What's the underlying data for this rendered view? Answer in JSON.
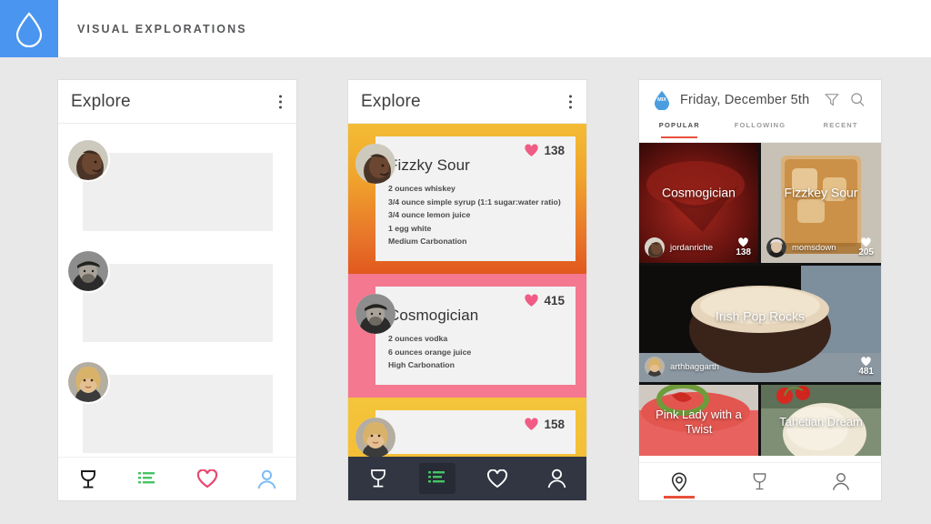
{
  "header": {
    "title": "VISUAL EXPLORATIONS",
    "logo_icon": "water-droplet-icon",
    "logo_bg": "#4a95f0"
  },
  "phone1": {
    "title": "Explore",
    "menu_icon": "kebab-menu-icon",
    "placeholder_rows": [
      {
        "avatar": "avatar-man-smiling"
      },
      {
        "avatar": "avatar-man-cap"
      },
      {
        "avatar": "avatar-woman-blonde"
      }
    ],
    "nav": [
      {
        "icon": "goblet-icon",
        "label": "Drinks",
        "color": "#1a1a1a"
      },
      {
        "icon": "list-icon",
        "label": "Recipes",
        "color": "#45c463"
      },
      {
        "icon": "heart-icon",
        "label": "Favorites",
        "color": "#e8486e"
      },
      {
        "icon": "person-icon",
        "label": "Profile",
        "color": "#7dbcf5"
      }
    ]
  },
  "phone2": {
    "title": "Explore",
    "menu_icon": "kebab-menu-icon",
    "cards": [
      {
        "name": "Fizzky Sour",
        "likes": "138",
        "avatar": "avatar-man-smiling",
        "ingredients": [
          "2 ounces whiskey",
          "3/4 ounce simple syrup (1:1 sugar:water ratio)",
          "3/4 ounce lemon juice",
          "1 egg white",
          "Medium Carbonation"
        ]
      },
      {
        "name": "Cosmogician",
        "likes": "415",
        "avatar": "avatar-man-cap",
        "ingredients": [
          "2 ounces vodka",
          "6 ounces orange juice",
          "High Carbonation"
        ]
      },
      {
        "name": "",
        "likes": "158",
        "avatar": "avatar-woman-blonde",
        "ingredients": []
      }
    ],
    "nav": [
      {
        "icon": "goblet-icon",
        "label": "Drinks",
        "active": false
      },
      {
        "icon": "list-icon",
        "label": "Recipes",
        "active": true
      },
      {
        "icon": "heart-icon",
        "label": "Favorites",
        "active": false
      },
      {
        "icon": "person-icon",
        "label": "Profile",
        "active": false
      }
    ],
    "nav_bg": "#313642",
    "nav_active_color": "#45c463"
  },
  "phone3": {
    "logo_icon": "droplet-mix-logo",
    "logo_text": "MIX",
    "date": "Friday, December 5th",
    "filter_icon": "filter-icon",
    "search_icon": "search-icon",
    "tabs": [
      {
        "label": "POPULAR",
        "active": true
      },
      {
        "label": "FOLLOWING",
        "active": false
      },
      {
        "label": "RECENT",
        "active": false
      }
    ],
    "accent_color": "#e8503a",
    "tiles": [
      {
        "name": "Cosmogician",
        "user": "jordanriche",
        "likes": "138",
        "avatar": "avatar-man-smiling"
      },
      {
        "name": "Fizzkey Sour",
        "user": "momsdown",
        "likes": "205",
        "avatar": "avatar-older-woman"
      },
      {
        "name": "Irish Pop Rocks",
        "user": "arthbaggarth",
        "likes": "481",
        "avatar": "avatar-woman-blonde"
      },
      {
        "name": "Pink Lady with a Twist",
        "user": "",
        "likes": "",
        "avatar": ""
      },
      {
        "name": "Tahetian Dream",
        "user": "",
        "likes": "",
        "avatar": ""
      }
    ],
    "nav": [
      {
        "icon": "location-pin-icon",
        "label": "Nearby",
        "active": true
      },
      {
        "icon": "goblet-icon",
        "label": "Drinks",
        "active": false
      },
      {
        "icon": "person-icon",
        "label": "Profile",
        "active": false
      }
    ]
  }
}
